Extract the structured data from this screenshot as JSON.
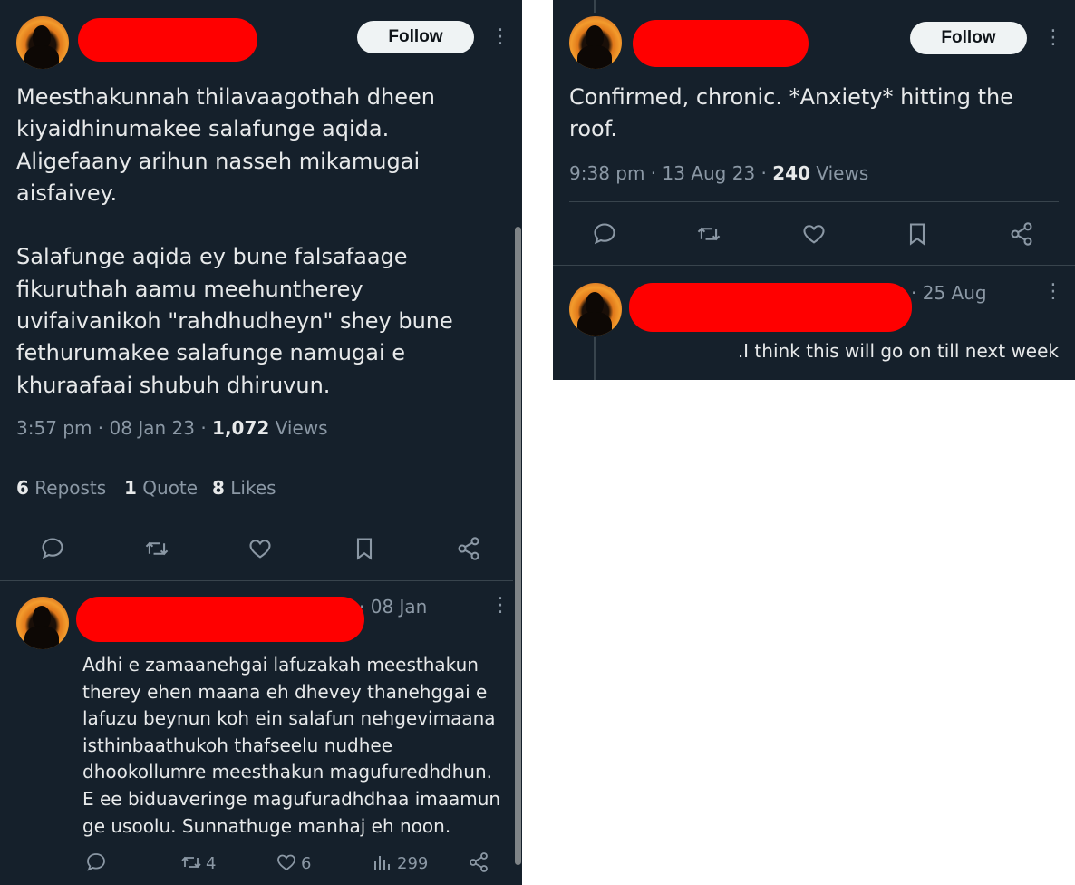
{
  "left": {
    "main_tweet": {
      "follow_label": "Follow",
      "text": "Meesthakunnah thilavaagothah dheen\nkiyaidhinumakee salafunge aqida.\nAligefaany arihun nasseh mikamugai\naisfaivey.\n\nSalafunge aqida ey bune falsafaage\nfikuruthah aamu meehuntherey\nuvifaivanikoh \"rahdhudheyn\" shey bune\nfethurumakee salafunge namugai e\nkhuraafaai shubuh dhiruvun.",
      "meta_prefix": "3:57 pm · 08 Jan 23 · ",
      "views_count": "1,072",
      "views_label": " Views",
      "reposts_count": "6",
      "reposts_label": " Reposts",
      "quotes_count": "1",
      "quotes_label": " Quote",
      "likes_count": "8",
      "likes_label": " Likes"
    },
    "reply": {
      "date": "· 08 Jan",
      "text": "Adhi e zamaanehgai lafuzakah meesthakun\ntherey ehen maana eh dhevey thanehggai e\nlafuzu beynun koh ein salafun nehgevimaana\nisthinbaathukoh thafseelu nudhee\ndhookollumre meesthakun magufuredhdhun.\nE ee biduaveringe magufuradhdhaa imaamun\nge usoolu. Sunnathuge manhaj eh noon.",
      "retweets": "4",
      "likes": "6",
      "views": "299"
    }
  },
  "right": {
    "main_tweet": {
      "follow_label": "Follow",
      "text": "Confirmed, chronic. *Anxiety* hitting the\nroof.",
      "meta_prefix": "9:38 pm · 13 Aug 23 · ",
      "views_count": "240",
      "views_label": " Views"
    },
    "reply": {
      "date": "· 25 Aug",
      "text": ".I think this will go on till next week"
    }
  },
  "colors": {
    "background": "#15202b",
    "text": "#e7e9ea",
    "secondary": "#8b98a5",
    "redaction": "#ff0000",
    "follow_bg": "#eff3f4"
  },
  "icons": [
    "reply-icon",
    "retweet-icon",
    "like-icon",
    "bookmark-icon",
    "share-icon",
    "views-icon",
    "more-icon"
  ]
}
